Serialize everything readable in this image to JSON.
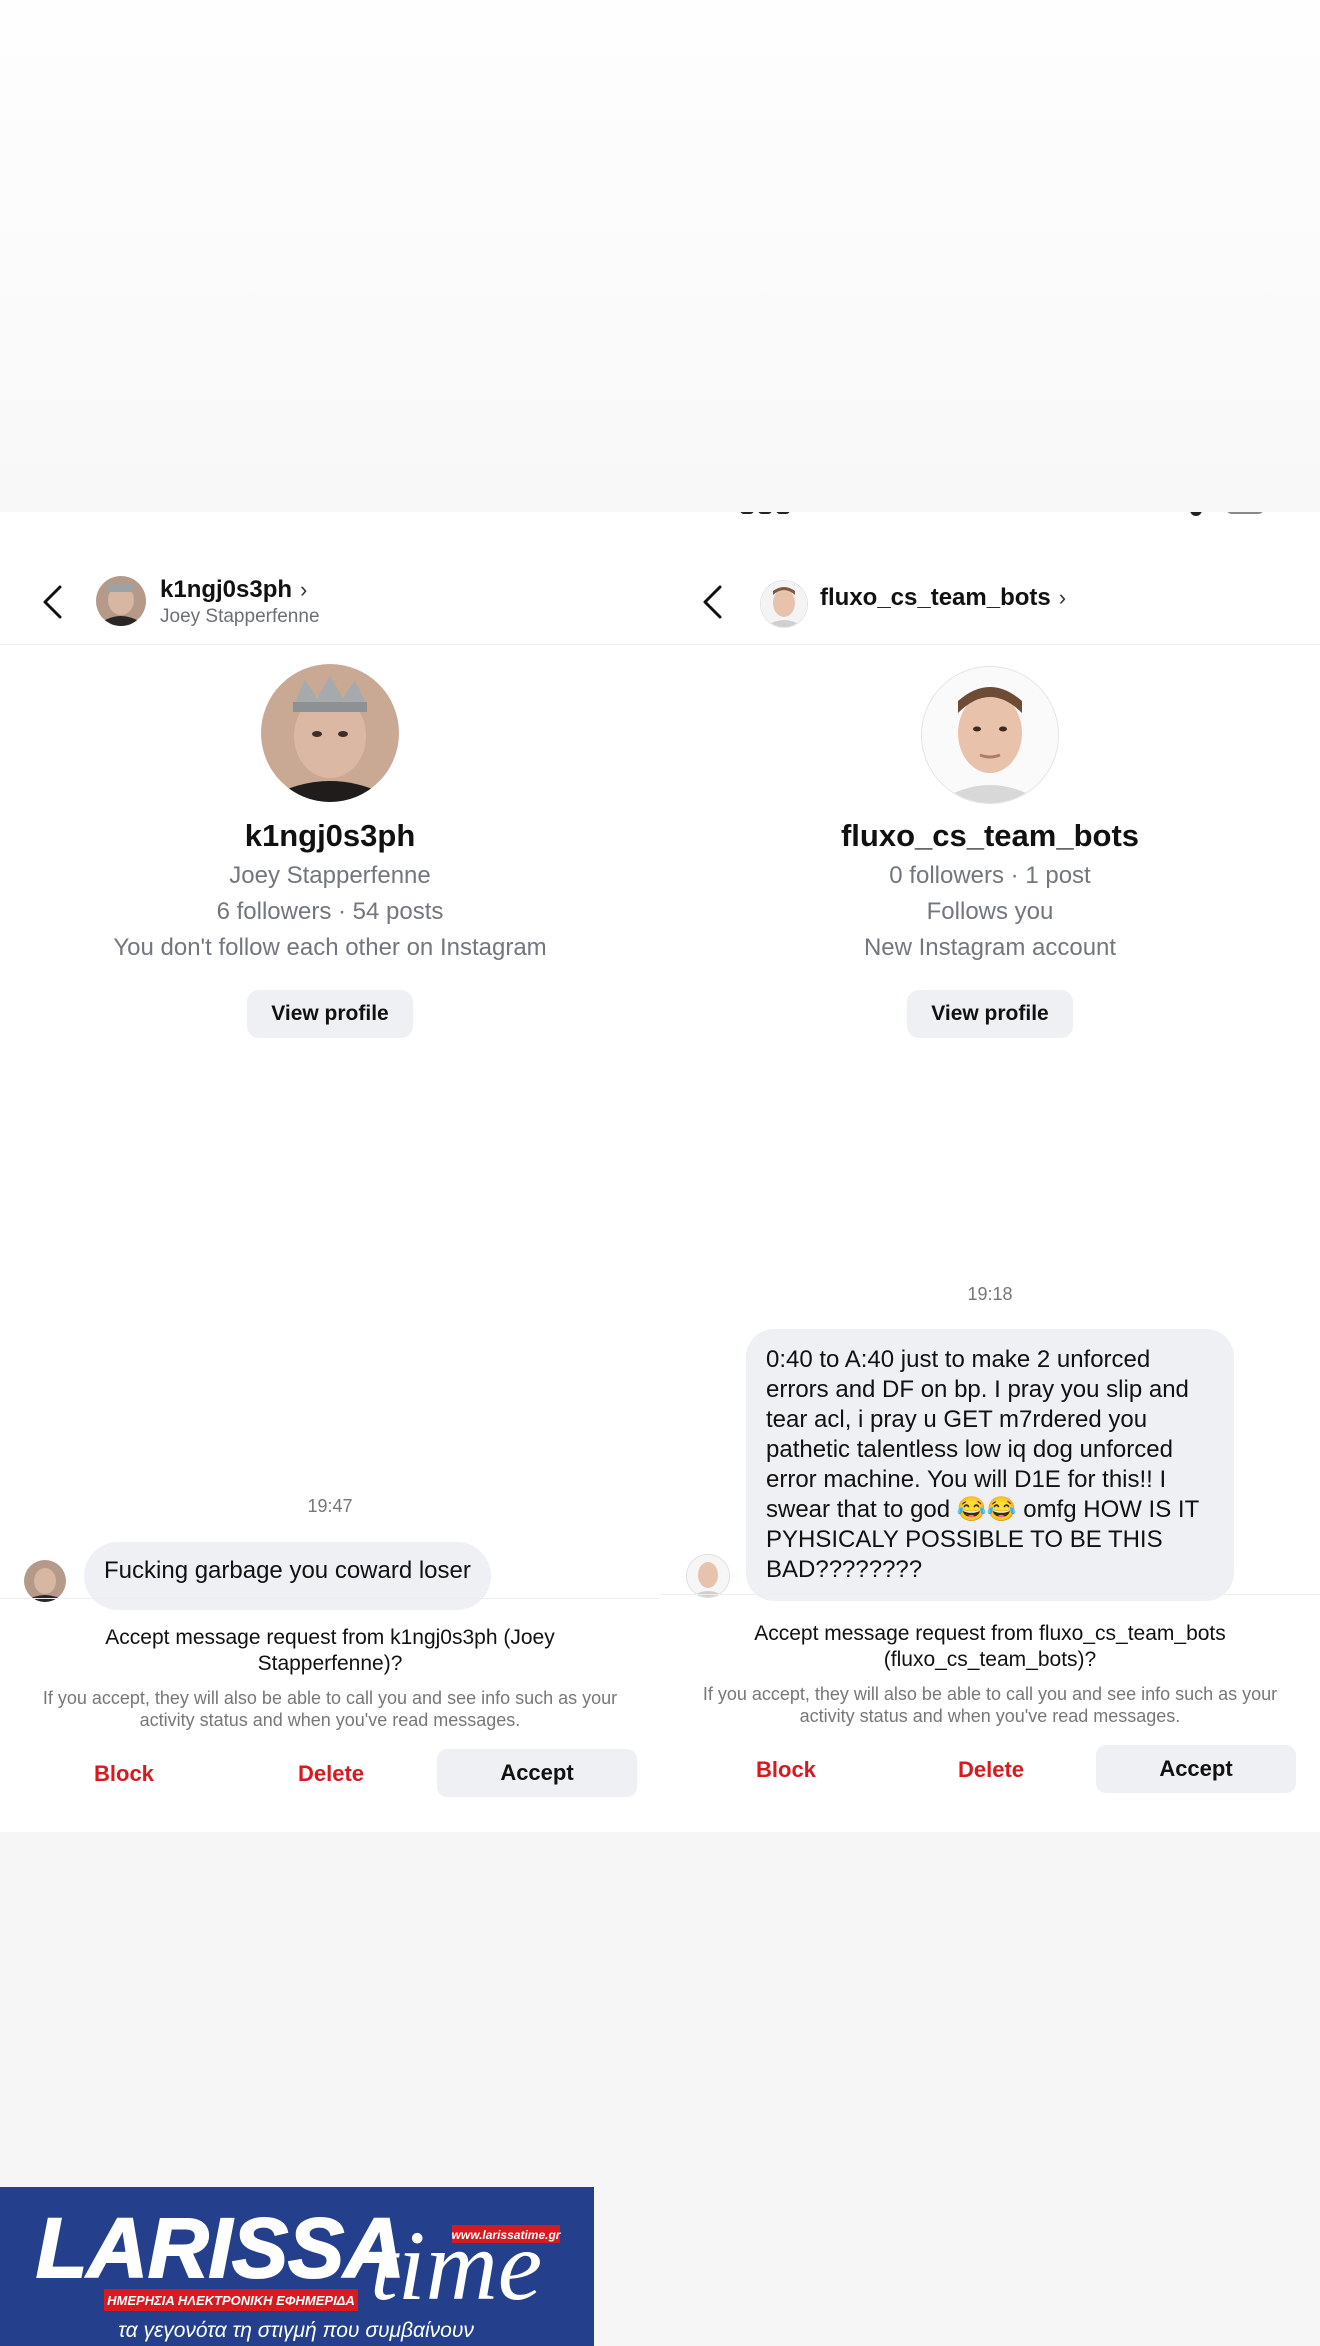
{
  "left_chat": {
    "header": {
      "username": "k1ngj0s3ph",
      "full_name": "Joey Stapperfenne"
    },
    "profile": {
      "username": "k1ngj0s3ph",
      "full_name": "Joey Stapperfenne",
      "stats": "6 followers · 54 posts",
      "relation": "You don't follow each other on Instagram",
      "view_profile_label": "View profile"
    },
    "message": {
      "time": "19:47",
      "text": "Fucking garbage you coward loser"
    },
    "request": {
      "title": "Accept message request from k1ngj0s3ph (Joey Stapperfenne)?",
      "subtitle": "If you accept, they will also be able to call you and see info such as your activity status and when you've read messages.",
      "block_label": "Block",
      "delete_label": "Delete",
      "accept_label": "Accept"
    }
  },
  "right_chat": {
    "header": {
      "username": "fluxo_cs_team_bots"
    },
    "profile": {
      "username": "fluxo_cs_team_bots",
      "stats": "0 followers · 1 post",
      "follows": "Follows you",
      "account_age": "New Instagram account",
      "view_profile_label": "View profile"
    },
    "message": {
      "time": "19:18",
      "text": "0:40 to A:40 just to make 2 unforced errors and DF on bp. I pray you slip and tear acl, i pray u GET m7rdered you pathetic talentless low iq dog unforced error machine. You will D1E for this!! I swear that to god 😂😂 omfg HOW IS IT PYHSICALY POSSIBLE TO BE THIS BAD????????"
    },
    "request": {
      "title": "Accept message request from fluxo_cs_team_bots (fluxo_cs_team_bots)?",
      "subtitle": "If you accept, they will also be able to call you and see info such as your activity status and when you've read messages.",
      "block_label": "Block",
      "delete_label": "Delete",
      "accept_label": "Accept"
    }
  },
  "watermark": {
    "brand": "LARISSA time",
    "url": "www.larissatime.gr",
    "subtitle": "ΗΜΕΡΗΣΙΑ ΗΛΕΚΤΡΟΝΙΚΗ ΕΦΗΜΕΡΙΔΑ",
    "tagline": "τα γεγονότα τη στιγμή που συμβαίνουν"
  },
  "colors": {
    "danger": "#d71920",
    "bubble": "#eef0f3",
    "muted": "#72767d",
    "banner_blue": "#243f8c"
  },
  "icons": [
    "back-icon",
    "chevron-right-icon",
    "avatar",
    "watermark-logo"
  ]
}
